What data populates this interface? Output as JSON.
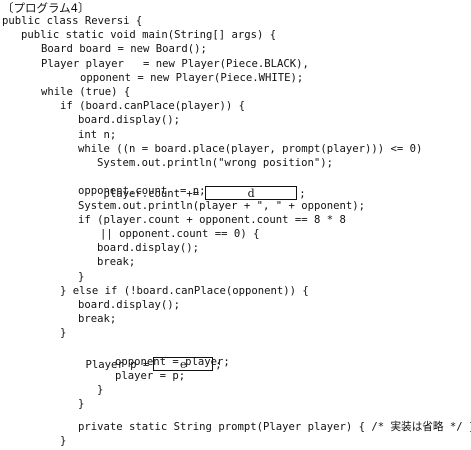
{
  "header": {
    "title": "〔プログラム4〕"
  },
  "code": {
    "l1": "public class Reversi {",
    "l2": "public static void main(String[] args) {",
    "l3": "Board board = new Board();",
    "l4": "Player player   = new Player(Piece.BLACK),",
    "l5": "opponent = new Player(Piece.WHITE);",
    "l6": "while (true) {",
    "l7": "if (board.canPlace(player)) {",
    "l8": "board.display();",
    "l9": "int n;",
    "l10": "while ((n = board.place(player, prompt(player))) <= 0)",
    "l11": "System.out.println(\"wrong position\");",
    "l12_pre": "player.count +=",
    "l12_post": ";",
    "l13": "opponent.count -= n;",
    "l14": "System.out.println(player + \", \" + opponent);",
    "l15": "if (player.count + opponent.count == 8 * 8",
    "l16": "|| opponent.count == 0) {",
    "l17": "board.display();",
    "l18": "break;",
    "l19": "}",
    "l20": "} else if (!board.canPlace(opponent)) {",
    "l21": "board.display();",
    "l22": "break;",
    "l23": "}",
    "l24_pre": "Player p =",
    "l24_post": ";",
    "l25": "opponent = player;",
    "l26": "player = p;",
    "l27": "}",
    "l28": "}",
    "l29_pre": "private static String prompt(Player player) { /* ",
    "l29_jp": "実装は省略",
    "l29_post": " */ }",
    "l30": "}"
  },
  "blanks": {
    "d": "d",
    "e": "e"
  }
}
